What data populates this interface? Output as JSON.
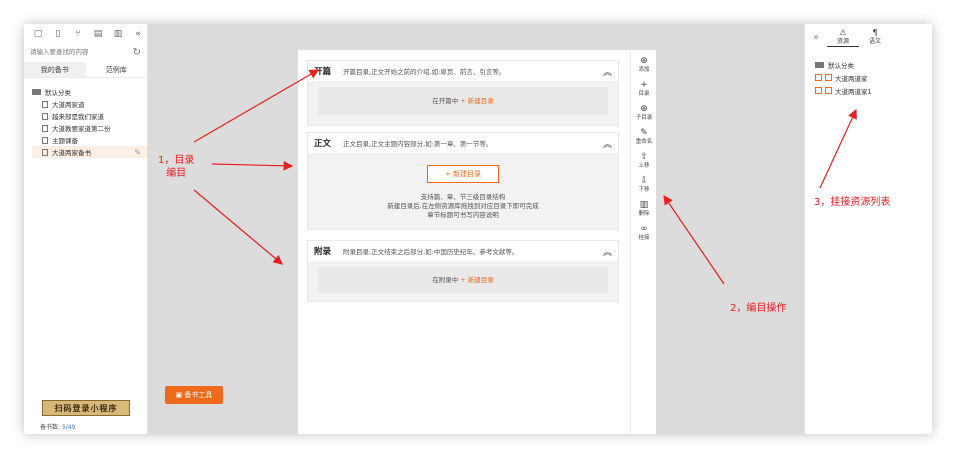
{
  "left_panel": {
    "toolbar_icons": [
      "new-folder-icon",
      "new-doc-icon",
      "branch-icon",
      "copy-icon",
      "trash-icon",
      "collapse-icon"
    ],
    "search_placeholder": "请输入要查找的内容",
    "tabs": [
      "我的备书",
      "范例库"
    ],
    "category": "默认分类",
    "items": [
      "大道两家道",
      "越来部是我们家道",
      "大道教要家道第二份",
      "主题课备",
      "大道两家备书"
    ],
    "banner": "扫码登录小程序",
    "count_label": "备书数:",
    "count_value": "5/49"
  },
  "tool_button": "备书工具",
  "center": {
    "sections": [
      {
        "title": "开篇",
        "desc": "开篇目录,正文开始之前的介绍,如:扉页、前言、引言等。",
        "body": "在开篇中",
        "link": "+ 新建目录"
      },
      {
        "title": "正文",
        "desc": "正文目录,正文主题内容部分,如:第一章、第一节等。",
        "button": "+ 新建目录",
        "help": [
          "支持篇、章、节三级目录结构",
          "新建目录后,在左侧资源库拖拽到对应目录下即可完成",
          "章节标题可书写内容说明"
        ]
      },
      {
        "title": "附录",
        "desc": "附录目录,正文结束之后部分,如:中国历史纪年、参考文献等。",
        "body": "在附录中",
        "link": "+ 新建目录"
      }
    ]
  },
  "vertical_toolbar": [
    {
      "icon": "add-circle-icon",
      "label": "添加"
    },
    {
      "icon": "plus-icon",
      "label": "目录"
    },
    {
      "icon": "sub-add-icon",
      "label": "子目录"
    },
    {
      "icon": "pencil-icon",
      "label": "重命名"
    },
    {
      "icon": "arrow-up-icon",
      "label": "上移"
    },
    {
      "icon": "arrow-down-icon",
      "label": "下移"
    },
    {
      "icon": "trash-icon",
      "label": "删除"
    },
    {
      "icon": "link-icon",
      "label": "挂接"
    }
  ],
  "right_panel": {
    "tabs": [
      "资源",
      "语文"
    ],
    "category": "默认分类",
    "resources": [
      "大道两道家",
      "大道两道家1"
    ]
  },
  "annotations": {
    "a1_line1": "1，目录",
    "a1_line2": "编目",
    "a2": "2，编目操作",
    "a3": "3，挂接资源列表"
  },
  "colors": {
    "accent": "#f06a1c",
    "annotation": "#e82020"
  }
}
